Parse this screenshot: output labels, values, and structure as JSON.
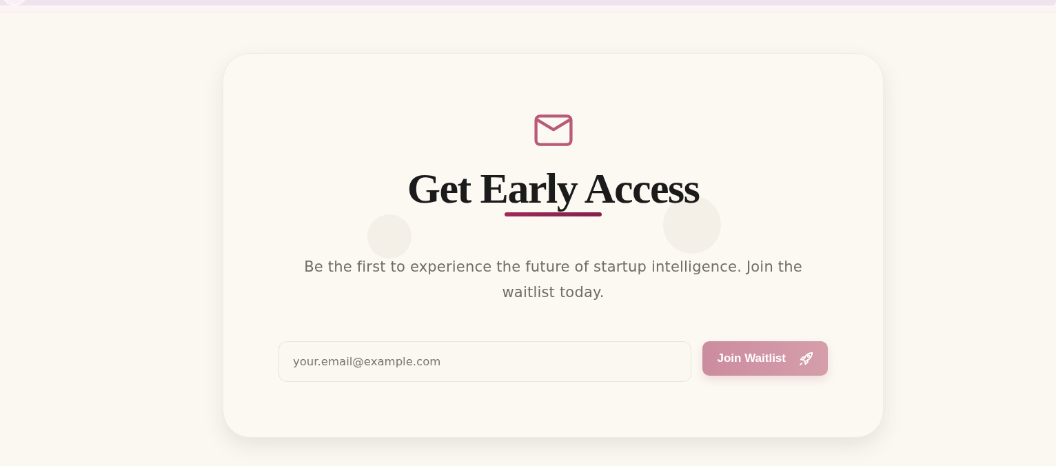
{
  "signup": {
    "title": "Get Early Access",
    "description": "Be the first to experience the future of startup intelligence. Join the waitlist today.",
    "email_field": {
      "placeholder": "your.email@example.com"
    },
    "submit_button": {
      "label": "Join Waitlist",
      "disabled": true
    }
  }
}
